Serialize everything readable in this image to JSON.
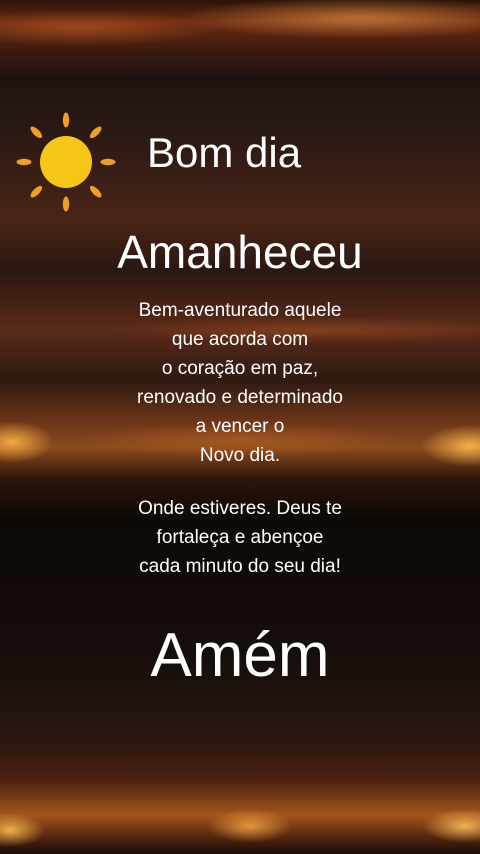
{
  "greeting": {
    "title": "Bom dia",
    "icon": "sun-icon",
    "sun_color": "#f5c518",
    "ray_color": "#f0a020"
  },
  "headline": "Amanheceu",
  "message": {
    "paragraph1": [
      "Bem-aventurado aquele",
      "que acorda com",
      "o coração em paz,",
      "renovado e determinado",
      "a vencer o",
      "Novo dia."
    ],
    "paragraph2": [
      "Onde estiveres. Deus te",
      "fortaleça e abençoe",
      "cada minuto do seu dia!"
    ]
  },
  "closing": "Amém"
}
